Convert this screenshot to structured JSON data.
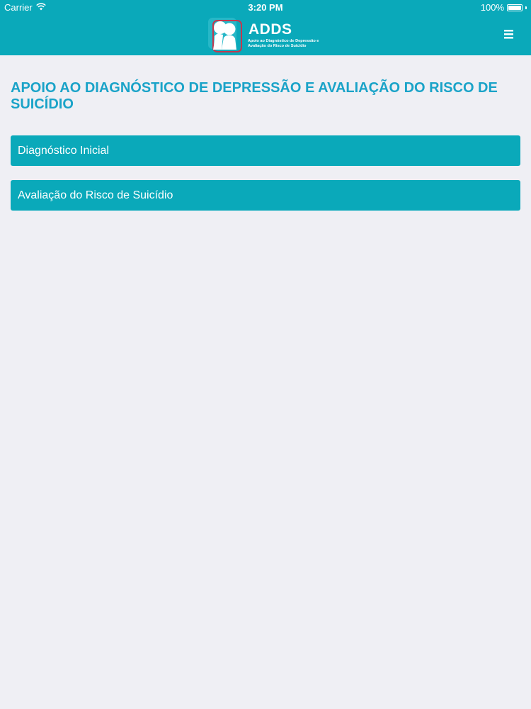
{
  "status_bar": {
    "carrier": "Carrier",
    "time": "3:20 PM",
    "battery": "100%"
  },
  "header": {
    "logo_title": "ADDS",
    "logo_subtitle_line1": "Apoio ao Diagnóstico de Depressão e",
    "logo_subtitle_line2": "Avaliação do Risco de Suicídio",
    "menu_icon": "hamburger-menu-icon",
    "background_color": "#0aa9ba"
  },
  "page": {
    "title": "APOIO AO DIAGNÓSTICO DE DEPRESSÃO E AVALIAÇÃO DO RISCO DE SUICÍDIO",
    "title_color": "#1aa3c8",
    "background_color": "#efeff4"
  },
  "menu": {
    "items": [
      {
        "label": "Diagnóstico Inicial"
      },
      {
        "label": "Avaliação do Risco de Suicídio"
      }
    ],
    "item_color": "#0aa9ba"
  }
}
